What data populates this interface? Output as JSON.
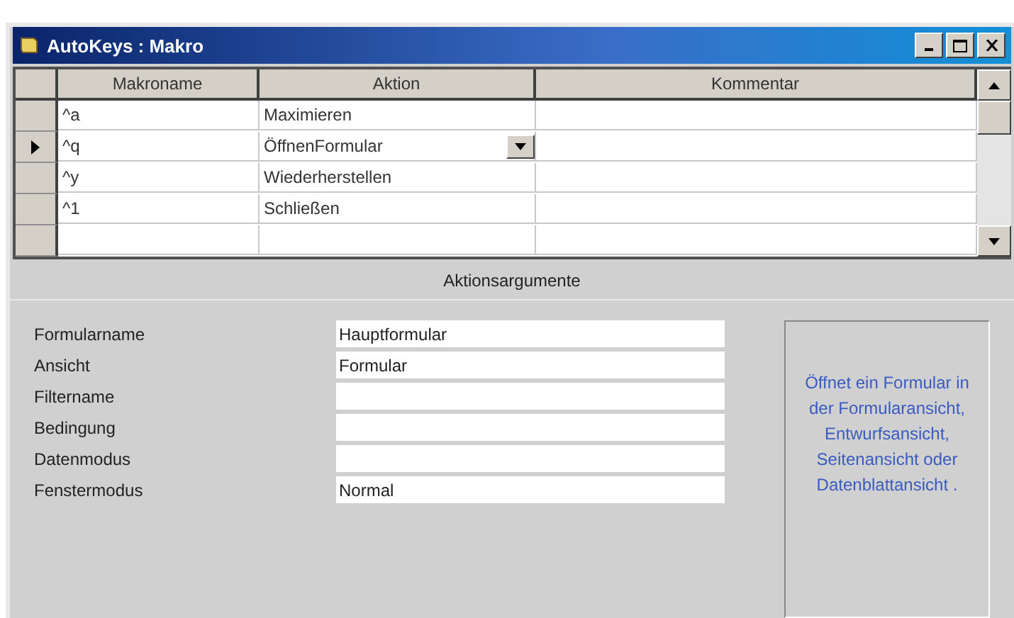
{
  "window": {
    "title": "AutoKeys : Makro"
  },
  "grid": {
    "columns": [
      "Makroname",
      "Aktion",
      "Kommentar"
    ],
    "rows": [
      {
        "name": "^a",
        "action": "Maximieren",
        "current": false
      },
      {
        "name": "^q",
        "action": "ÖffnenFormular",
        "current": true
      },
      {
        "name": "^y",
        "action": "Wiederherstellen",
        "current": false
      },
      {
        "name": "^1",
        "action": "Schließen",
        "current": false
      },
      {
        "current": false
      }
    ]
  },
  "arguments": {
    "title": "Aktionsargumente",
    "fields": [
      {
        "label": "Formularname",
        "value": "Hauptformular"
      },
      {
        "label": "Ansicht",
        "value": "Formular"
      },
      {
        "label": "Filtername"
      },
      {
        "label": "Bedingung"
      },
      {
        "label": "Datenmodus"
      },
      {
        "label": "Fenstermodus",
        "value": "Normal"
      }
    ],
    "help": "Öffnet ein Formular in der Formularansicht, Entwurfsansicht, Seitenansicht oder Datenblattansicht ."
  }
}
